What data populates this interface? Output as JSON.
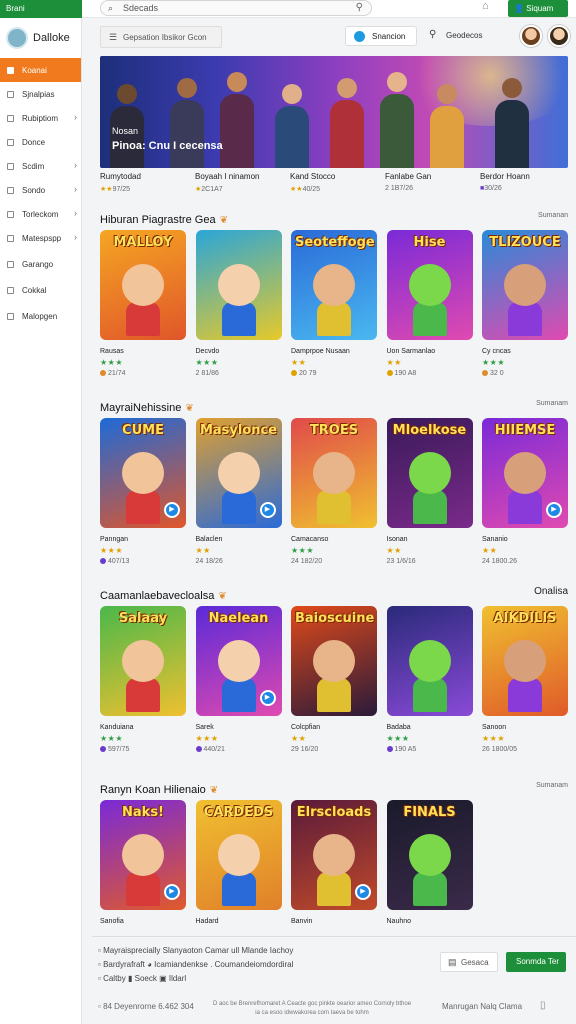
{
  "topbar": {
    "brand": "Brani",
    "search_placeholder": "Sdecads",
    "signin_label": "Siquam"
  },
  "sidebar": {
    "title": "Dalloke",
    "items": [
      {
        "label": "Koanai",
        "active": true,
        "chevron": false
      },
      {
        "label": "Sjnalpias",
        "active": false,
        "chevron": false
      },
      {
        "label": "Rubiptiom",
        "active": false,
        "chevron": true
      },
      {
        "label": "Donce",
        "active": false,
        "chevron": false
      },
      {
        "label": "Scdim",
        "active": false,
        "chevron": true
      },
      {
        "label": "Sondo",
        "active": false,
        "chevron": true
      },
      {
        "label": "Torleckom",
        "active": false,
        "chevron": true
      },
      {
        "label": "Matespspp",
        "active": false,
        "chevron": true
      },
      {
        "label": "Garango",
        "active": false,
        "chevron": false
      },
      {
        "label": "Cokkal",
        "active": false,
        "chevron": false
      },
      {
        "label": "Malopgen",
        "active": false,
        "chevron": false
      }
    ]
  },
  "subbar": {
    "filter_label": "Gepsation Ibsikor Gcon",
    "search_label": "Snancion",
    "right_label": "Geodecos"
  },
  "hero": {
    "line1": "Nosan",
    "line2": "Pinoa: Cnu I cecensa"
  },
  "strip": [
    {
      "title": "Rumytodad",
      "rating": "★★",
      "meta": "97/25",
      "badge": "star"
    },
    {
      "title": "Boyaah I ninamon",
      "rating": "★",
      "meta": "2C1A7",
      "badge": "star"
    },
    {
      "title": "Kand Stocco",
      "rating": "★★",
      "meta": "40/25",
      "badge": "star"
    },
    {
      "title": "Fanlabe Gan",
      "rating": "",
      "meta": "2 1B7/26",
      "badge": "none"
    },
    {
      "title": "Berdor Hoann",
      "rating": "",
      "meta": "30/26",
      "badge": "purple"
    }
  ],
  "sections": [
    {
      "title": "Hiburan Piagrastre Gea",
      "link": "Sumanan",
      "cards": [
        {
          "title": "Rausas",
          "stars": "★★★",
          "star_color": "#2f9e44",
          "meta": "21/74",
          "badge_color": "#e08a2a",
          "logo": "MALLOY",
          "play": false
        },
        {
          "title": "Decvdo",
          "stars": "★★★",
          "star_color": "#2f9e44",
          "meta": "2 81/86",
          "badge_color": "",
          "logo": "",
          "play": false
        },
        {
          "title": "Damprpoe Nusaan",
          "stars": "★★",
          "star_color": "#e0a100",
          "meta": "20 79",
          "badge_color": "#e0a100",
          "logo": "Seoteffoge",
          "play": false
        },
        {
          "title": "Uon Sarmanlao",
          "stars": "★★",
          "star_color": "#e0a100",
          "meta": "190 A8",
          "badge_color": "#e0a100",
          "logo": "Hise",
          "play": false
        },
        {
          "title": "Cy cncas",
          "stars": "★★★",
          "star_color": "#2f9e44",
          "meta": "32 0",
          "badge_color": "#e08a2a",
          "logo": "TLIZOUCE",
          "play": false
        }
      ]
    },
    {
      "title": "MayraiNehissine",
      "link": "Sumanam",
      "cards": [
        {
          "title": "Panngan",
          "stars": "★★★",
          "star_color": "#e0a100",
          "meta": "407/13",
          "badge_color": "#6b3ccc",
          "logo": "CUME",
          "play": true
        },
        {
          "title": "Balaclen",
          "stars": "★★",
          "star_color": "#e0a100",
          "meta": "24 18/26",
          "badge_color": "",
          "logo": "Masylonce",
          "play": true
        },
        {
          "title": "Camacanso",
          "stars": "★★★",
          "star_color": "#2f9e44",
          "meta": "24 182/20",
          "badge_color": "",
          "logo": "TROES",
          "play": false
        },
        {
          "title": "Isonan",
          "stars": "★★",
          "star_color": "#e0a100",
          "meta": "23 1/6/16",
          "badge_color": "",
          "logo": "Mloelkose",
          "play": false
        },
        {
          "title": "Sananio",
          "stars": "★★",
          "star_color": "#e0a100",
          "meta": "24 1800.26",
          "badge_color": "",
          "logo": "HIIEMSE",
          "play": true
        }
      ]
    },
    {
      "title": "Caamanlaebavecloalsa",
      "link": "Onalisa",
      "cards": [
        {
          "title": "Kanduiana",
          "stars": "★★★",
          "star_color": "#2f9e44",
          "meta": "597/75",
          "badge_color": "#6b3ccc",
          "logo": "Salaay",
          "play": false
        },
        {
          "title": "Sarek",
          "stars": "★★★",
          "star_color": "#e0a100",
          "meta": "440/21",
          "badge_color": "#6b3ccc",
          "logo": "Naelean",
          "play": true
        },
        {
          "title": "Colcpfian",
          "stars": "★★",
          "star_color": "#e0a100",
          "meta": "29 16/20",
          "badge_color": "",
          "logo": "Baioscuine",
          "play": false
        },
        {
          "title": "Badaba",
          "stars": "★★★",
          "star_color": "#2f9e44",
          "meta": "190 A5",
          "badge_color": "#6b3ccc",
          "logo": "",
          "play": false
        },
        {
          "title": "Sanoon",
          "stars": "★★★",
          "star_color": "#e0a100",
          "meta": "26 1800/05",
          "badge_color": "",
          "logo": "AIKDILIS",
          "play": false
        }
      ]
    },
    {
      "title": "Ranyn Koan Hilienaio",
      "link": "Sumanam",
      "cards": [
        {
          "title": "Sanofia",
          "stars": "",
          "star_color": "",
          "meta": "",
          "badge_color": "",
          "logo": "Naks!",
          "play": true
        },
        {
          "title": "Hadard",
          "stars": "",
          "star_color": "",
          "meta": "",
          "badge_color": "",
          "logo": "CARDEDS",
          "play": false
        },
        {
          "title": "Banvin",
          "stars": "",
          "star_color": "",
          "meta": "",
          "badge_color": "",
          "logo": "Elrscloads",
          "play": true
        },
        {
          "title": "Nauhno",
          "stars": "",
          "star_color": "",
          "meta": "",
          "badge_color": "",
          "logo": "FINALS",
          "play": false
        }
      ]
    }
  ],
  "footer": {
    "line1": "Mayraisprecially Slanyaoton Camar ull Mlande Iachoy",
    "line2": "Bardyrafraft",
    "line2b": "Icamiandenkse . Coumandeiomdordiral",
    "line3a": "Caltby",
    "line3b": "Soeck",
    "line3c": "Ildarl",
    "btn_secondary": "Gesaca",
    "btn_primary": "Sonmda Ter",
    "copyright": "84 Deyenrorne 6.462 304",
    "fine_print": "D aoc be Brenrefhomaret A Ceacte goc pinkte oearior ameo Cornoly bthoe ia ca esoo idwwakorea com Iaeva be tohm",
    "right_label": "Manrugan Nalq Clama"
  }
}
